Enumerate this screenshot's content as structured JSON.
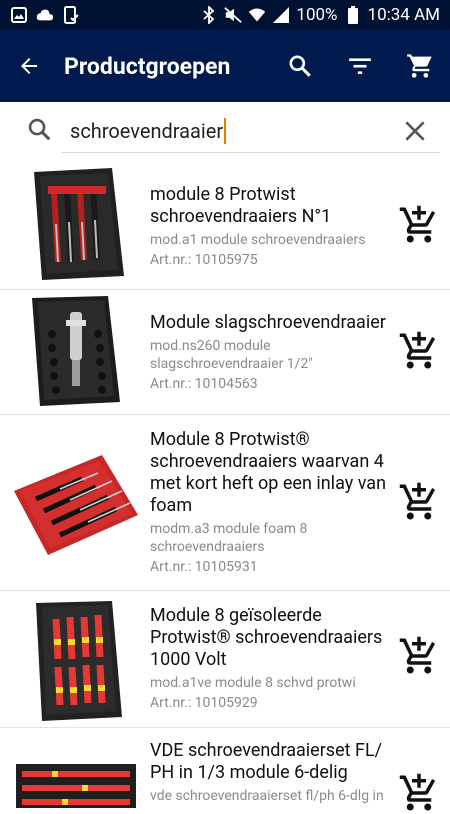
{
  "status": {
    "battery": "100%",
    "time": "10:34 AM"
  },
  "appbar": {
    "title": "Productgroepen",
    "icons": [
      "back-arrow-icon",
      "search-icon",
      "filter-icon",
      "cart-icon"
    ]
  },
  "search": {
    "value": "schroevendraaier"
  },
  "products": [
    {
      "name": "module 8 Protwist schroevendraaiers N°1",
      "desc": "mod.a1 module schroevendraaiers",
      "art": "Art.nr.: 10105975"
    },
    {
      "name": "Module slagschroevendraaier",
      "desc": "mod.ns260 module slagschroevendraaier 1/2\"",
      "art": "Art.nr.: 10104563"
    },
    {
      "name": "Module 8 Protwist® schroevendraaiers waarvan 4 met kort heft op een inlay van foam",
      "desc": "modm.a3 module foam 8 schroevendraaiers",
      "art": "Art.nr.: 10105931"
    },
    {
      "name": "Module 8 geïsoleerde Protwist® schroevendraaiers 1000 Volt",
      "desc": "mod.a1ve module 8 schvd protwi",
      "art": "Art.nr.: 10105929"
    },
    {
      "name": "VDE schroevendraaierset FL/ PH in 1/3 module 6-delig",
      "desc": "vde schroevendraaierset fl/ph 6-dlg in",
      "art": ""
    }
  ],
  "colors": {
    "statusbar": "#001233",
    "appbar": "#001a4d",
    "caret": "#f07b00"
  }
}
